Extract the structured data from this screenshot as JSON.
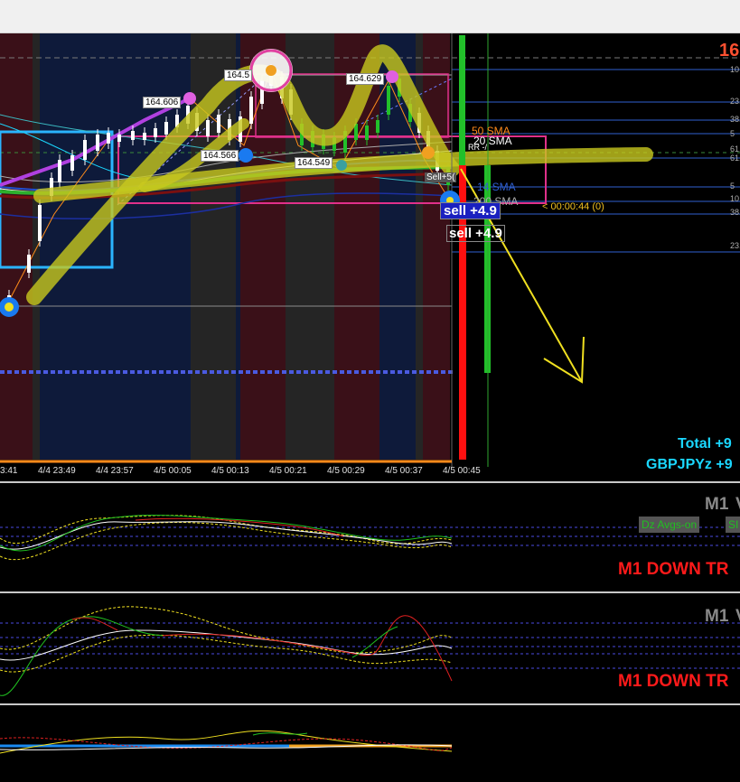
{
  "main_chart": {
    "price_edge_label": "16",
    "price_flags": [
      "164.606",
      "164.5",
      "164.629",
      "164.566",
      "164.549"
    ],
    "sma_labels": [
      "50 SMA",
      "20 SMA",
      "14 SMA",
      "200 SMA"
    ],
    "rr_label": "RR -/",
    "sell_tag": "Sell+5(",
    "countdown": "< 00:00:44 (0)",
    "sell_signals": [
      "sell +4.9",
      "sell +4.9"
    ],
    "time_axis": [
      "3:41",
      "4/4 23:49",
      "4/4 23:57",
      "4/5 00:05",
      "4/5 00:13",
      "4/5 00:21",
      "4/5 00:29",
      "4/5 00:37",
      "4/5 00:45"
    ],
    "right_axis": [
      "10",
      "23.",
      "38.",
      "5",
      "61.",
      "61.",
      "5",
      "10",
      "38.",
      "23."
    ],
    "totals": {
      "total": "Total +9",
      "symbol": "GBPJPYz +9"
    }
  },
  "indicator_1": {
    "title": "M1",
    "title_edge": "V",
    "buttons": [
      "Dz Avgs-on",
      "SI"
    ],
    "trend": "M1 DOWN TR"
  },
  "indicator_2": {
    "title": "M1",
    "title_edge": "V",
    "trend": "M1 DOWN TR"
  },
  "colors": {
    "bg": "#000000",
    "bear_zone": "#3a1018",
    "bull_zone": "#0e1a3a",
    "neutral_zone": "#252525",
    "sell_red": "#ff1010",
    "buy_green": "#22c02a",
    "highlighter": "#c8c81e",
    "cyan_text": "#1ad7ff",
    "trend_red": "#ff1a1a"
  }
}
